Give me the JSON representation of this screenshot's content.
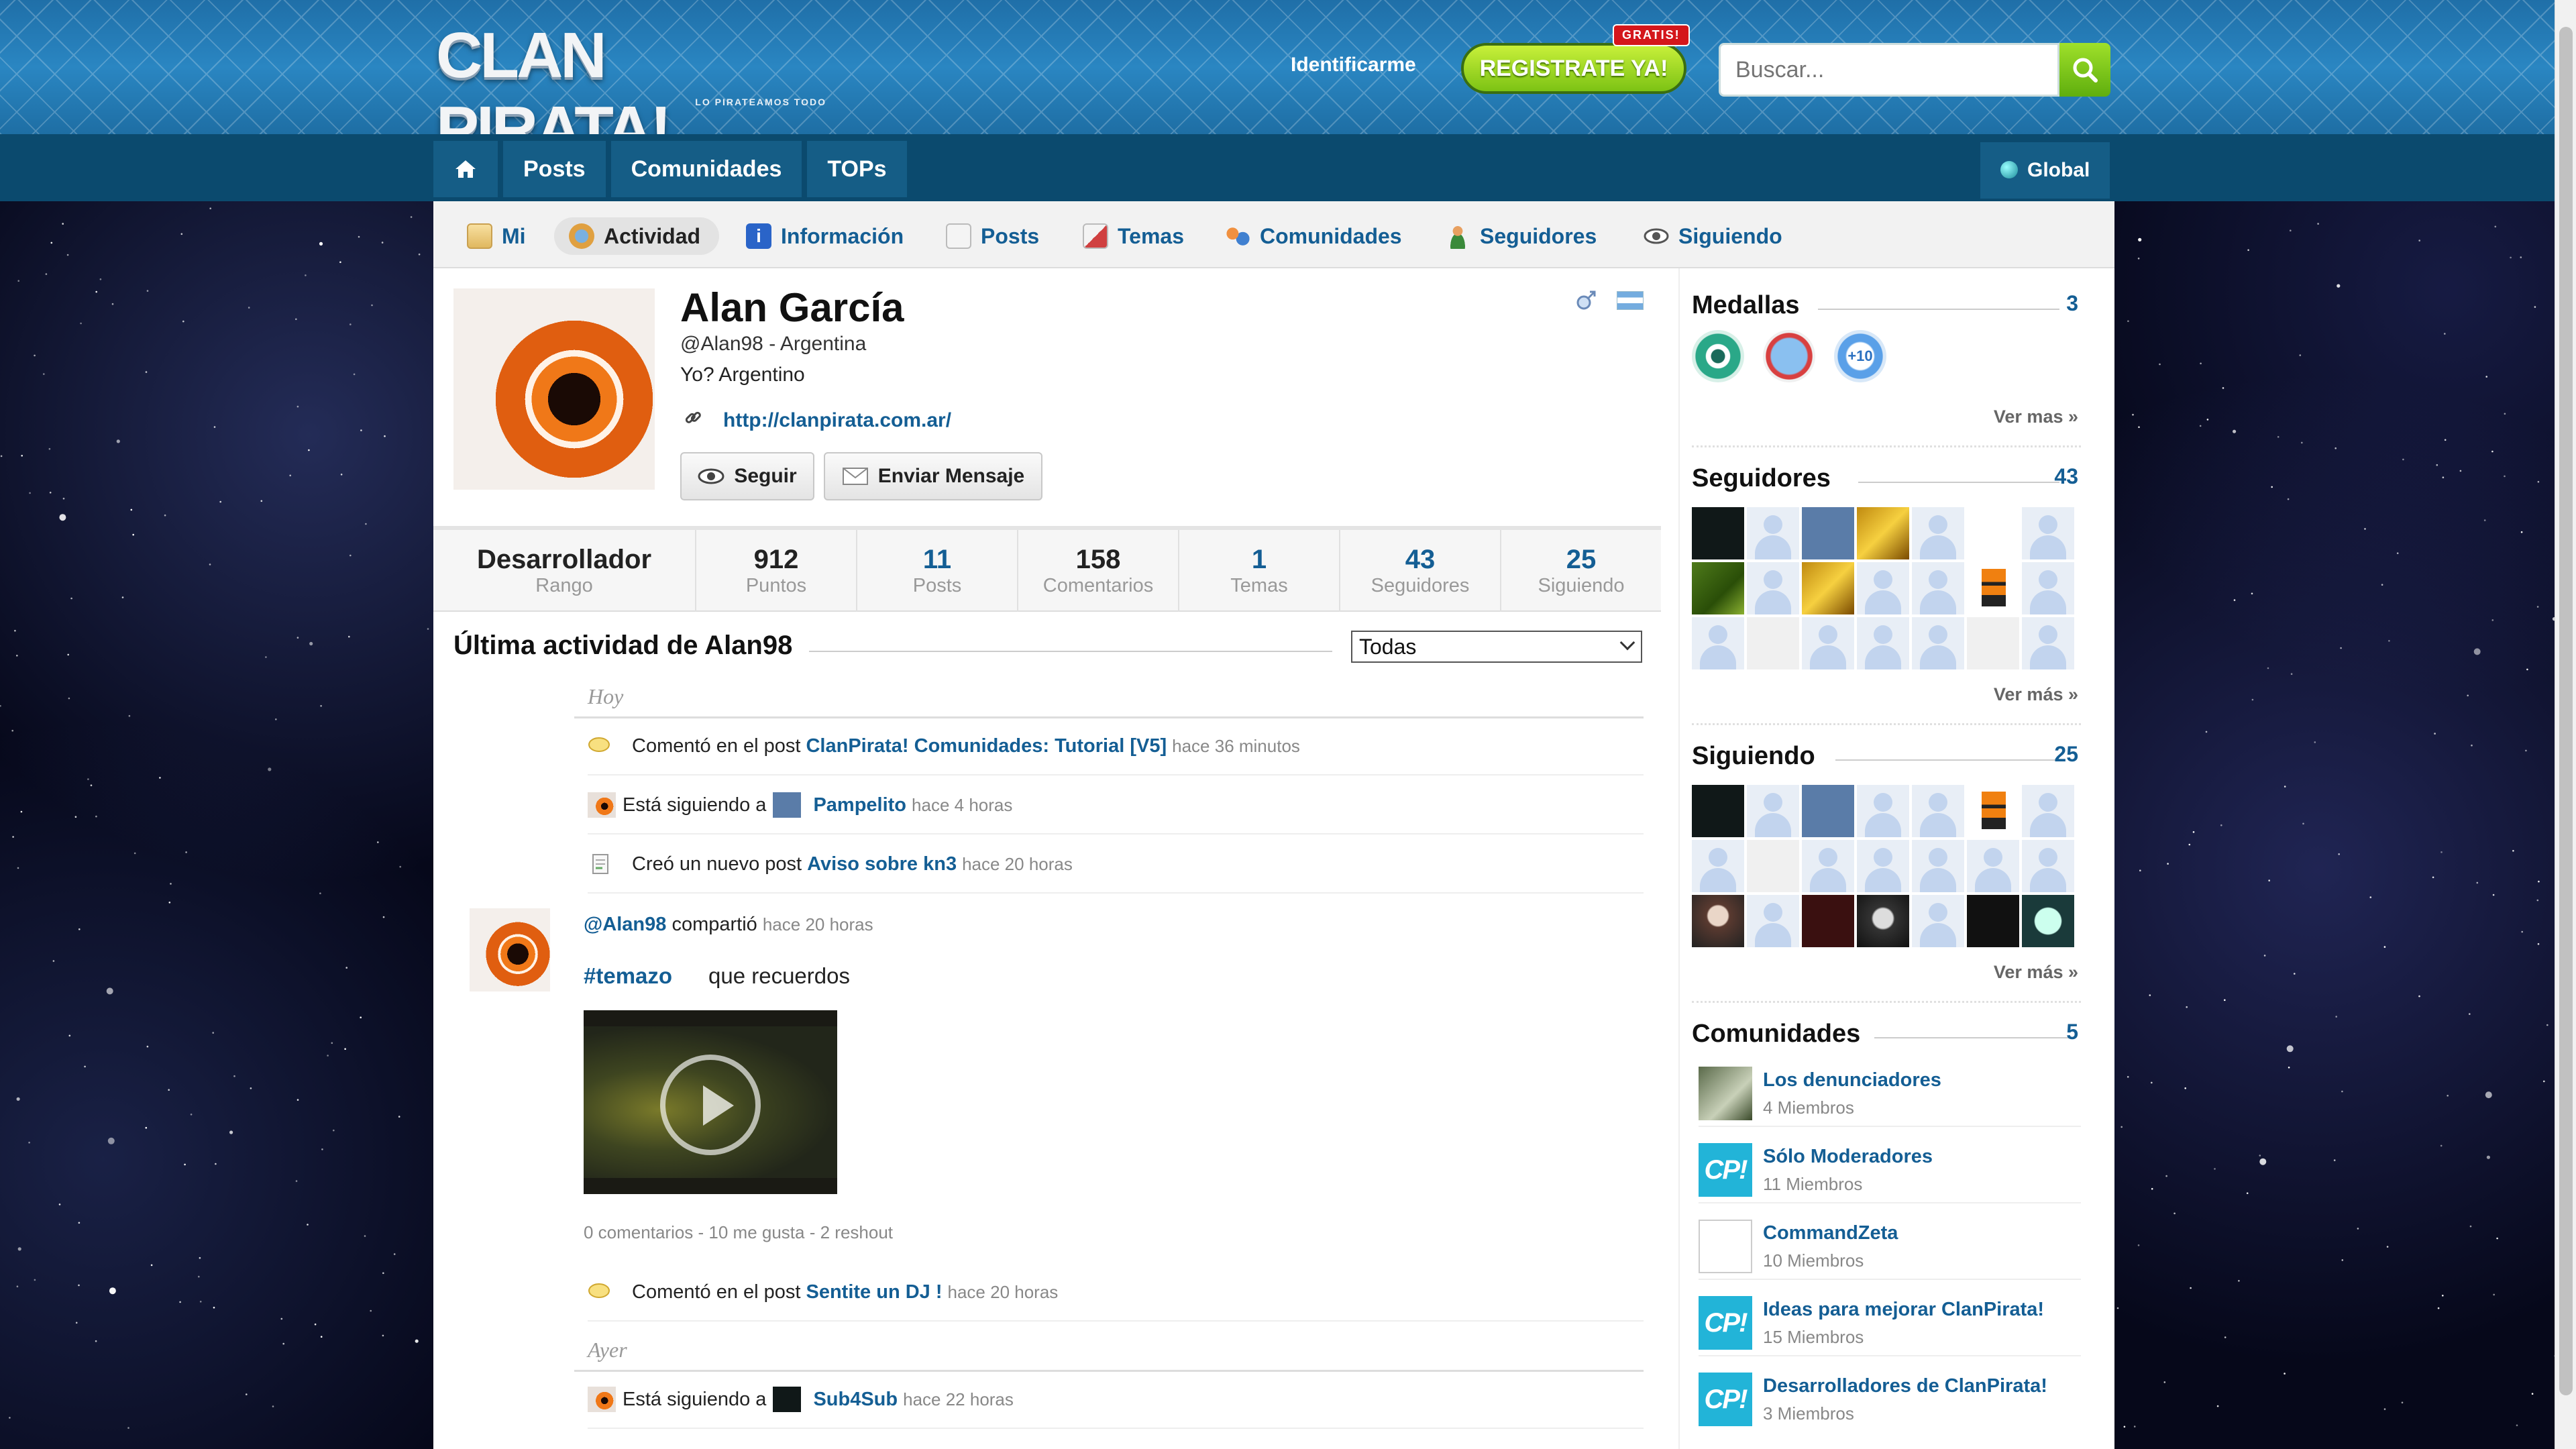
{
  "header": {
    "logo_text": "CLAN PIRATA!",
    "logo_subtitle": "LO PIRATEAMOS TODO",
    "login_label": "Identificarme",
    "register_label": "REGISTRATE YA!",
    "register_badge": "GRATIS!",
    "search_placeholder": "Buscar..."
  },
  "nav": {
    "items": [
      "Posts",
      "Comunidades",
      "TOPs"
    ],
    "global_label": "Global"
  },
  "subnav": {
    "items": [
      {
        "label": "Mi",
        "icon": "profile-card-icon"
      },
      {
        "label": "Actividad",
        "icon": "activity-icon"
      },
      {
        "label": "Información",
        "icon": "info-icon"
      },
      {
        "label": "Posts",
        "icon": "document-icon"
      },
      {
        "label": "Temas",
        "icon": "topics-icon"
      },
      {
        "label": "Comunidades",
        "icon": "communities-icon"
      },
      {
        "label": "Seguidores",
        "icon": "followers-icon"
      },
      {
        "label": "Siguiendo",
        "icon": "eye-icon"
      }
    ],
    "active": "Actividad"
  },
  "profile": {
    "name": "Alan García",
    "handle_line": "@Alan98 - Argentina",
    "bio": "Yo? Argentino",
    "website": "http://clanpirata.com.ar/",
    "follow_label": "Seguir",
    "message_label": "Enviar Mensaje"
  },
  "stats": {
    "rank": {
      "value": "Desarrollador",
      "label": "Rango"
    },
    "points": {
      "value": "912",
      "label": "Puntos"
    },
    "posts": {
      "value": "11",
      "label": "Posts"
    },
    "comments": {
      "value": "158",
      "label": "Comentarios"
    },
    "topics": {
      "value": "1",
      "label": "Temas"
    },
    "followers": {
      "value": "43",
      "label": "Seguidores"
    },
    "following": {
      "value": "25",
      "label": "Siguiendo"
    }
  },
  "activity": {
    "title": "Última actividad de Alan98",
    "filter_value": "Todas",
    "today_label": "Hoy",
    "yesterday_label": "Ayer",
    "items": [
      {
        "text": "Comentó en el post",
        "link": "ClanPirata! Comunidades: Tutorial [V5]",
        "time": "hace 36 minutos"
      },
      {
        "text": "Está siguiendo a",
        "link": "Pampelito",
        "time": "hace 4 horas"
      },
      {
        "text": "Creó un nuevo post",
        "link": "Aviso sobre kn3",
        "time": "hace 20 horas"
      },
      {
        "text": "Comentó en el post",
        "link": "Sentite un DJ !",
        "time": "hace 20 horas"
      },
      {
        "text": "Está siguiendo a",
        "link": "Sub4Sub",
        "time": "hace 22 horas"
      }
    ],
    "shared": {
      "user": "@Alan98",
      "verb": "compartió",
      "time": "hace 20 horas",
      "hashtag": "#temazo",
      "message": "que recuerdos",
      "meta": "0 comentarios - 10 me gusta - 2 reshout"
    }
  },
  "sidebar": {
    "medals": {
      "title": "Medallas",
      "count": "3",
      "more": "Ver mas »"
    },
    "followers": {
      "title": "Seguidores",
      "count": "43",
      "more": "Ver más »"
    },
    "following": {
      "title": "Siguiendo",
      "count": "25",
      "more": "Ver más »"
    },
    "communities": {
      "title": "Comunidades",
      "count": "5",
      "items": [
        {
          "name": "Los denunciadores",
          "members": "4 Miembros"
        },
        {
          "name": "Sólo Moderadores",
          "members": "11 Miembros"
        },
        {
          "name": "CommandZeta",
          "members": "10 Miembros"
        },
        {
          "name": "Ideas para mejorar ClanPirata!",
          "members": "15 Miembros"
        },
        {
          "name": "Desarrolladores de ClanPirata!",
          "members": "3 Miembros"
        }
      ]
    }
  },
  "colors": {
    "link": "#145e94",
    "header": "#2a86c2",
    "nav": "#0b4a6e",
    "register": "#7cc214"
  }
}
